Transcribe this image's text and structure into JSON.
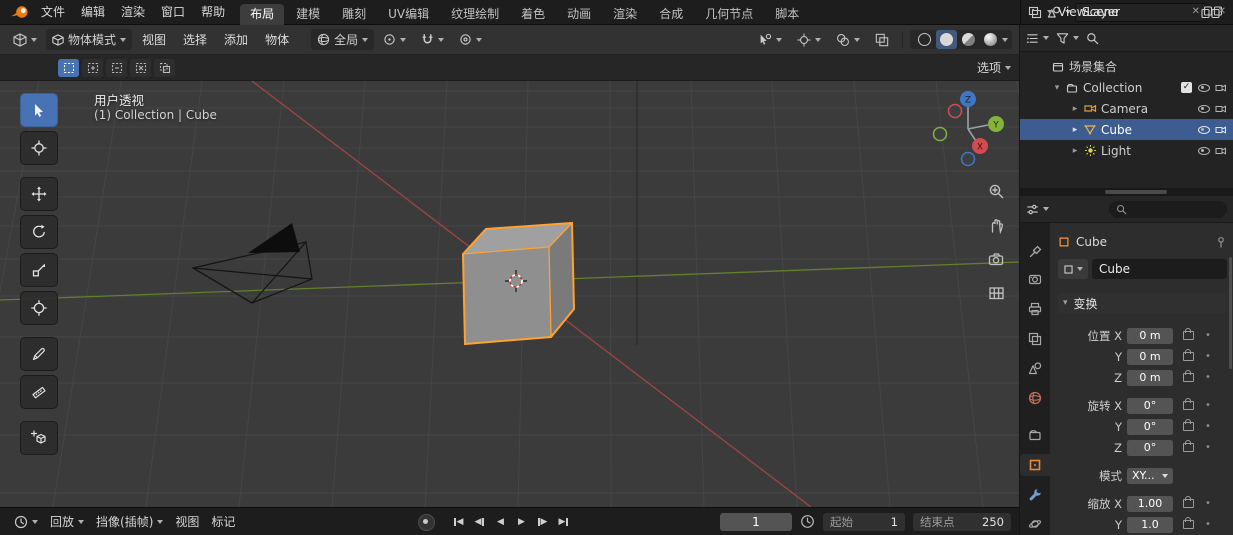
{
  "icons": {
    "disclosure_open": "▾",
    "disclosure_closed": "▸",
    "check": "✓",
    "close": "✕",
    "tri_left": "◀",
    "tri_right": "▶",
    "dot": "•"
  },
  "colors": {
    "accent": "#4772b3",
    "object_orange": "#e8883a",
    "selection_outline": "#ffa133",
    "axis_x": "#d24b52",
    "axis_y": "#84b33c",
    "axis_z": "#4076c4"
  },
  "topbar": {
    "menus": [
      {
        "label": "文件"
      },
      {
        "label": "编辑"
      },
      {
        "label": "渲染"
      },
      {
        "label": "窗口"
      },
      {
        "label": "帮助"
      }
    ],
    "tabs": [
      {
        "label": "布局"
      },
      {
        "label": "建模"
      },
      {
        "label": "雕刻"
      },
      {
        "label": "UV编辑"
      },
      {
        "label": "纹理绘制"
      },
      {
        "label": "着色"
      },
      {
        "label": "动画"
      },
      {
        "label": "渲染"
      },
      {
        "label": "合成"
      },
      {
        "label": "几何节点"
      },
      {
        "label": "脚本"
      }
    ],
    "scene_value": "Scene",
    "view_layer_value": "ViewLayer"
  },
  "viewport_header": {
    "mode": "物体模式",
    "menus": [
      {
        "label": "视图"
      },
      {
        "label": "选择"
      },
      {
        "label": "添加"
      },
      {
        "label": "物体"
      }
    ],
    "orientation": "全局",
    "options_label": "选项"
  },
  "viewport": {
    "view_name": "用户透视",
    "context_path": "(1) Collection | Cube",
    "gizmo": {
      "x": "X",
      "y": "Y",
      "z": "Z"
    }
  },
  "outliner": {
    "root": "场景集合",
    "items": [
      {
        "name": "Collection"
      },
      {
        "name": "Camera"
      },
      {
        "name": "Cube"
      },
      {
        "name": "Light"
      }
    ]
  },
  "properties": {
    "breadcrumb": "Cube",
    "name_value": "Cube",
    "transform": {
      "title": "变换",
      "rows": [
        {
          "label": "位置 X",
          "value": "0 m"
        },
        {
          "label": "Y",
          "value": "0 m"
        },
        {
          "label": "Z",
          "value": "0 m"
        },
        {
          "label": "旋转 X",
          "value": "0°"
        },
        {
          "label": "Y",
          "value": "0°"
        },
        {
          "label": "Z",
          "value": "0°"
        },
        {
          "label": "模式",
          "value": "XY..."
        },
        {
          "label": "缩放 X",
          "value": "1.00"
        },
        {
          "label": "Y",
          "value": "1.0"
        }
      ]
    }
  },
  "timeline": {
    "menus": [
      {
        "label": "回放"
      },
      {
        "label": "挡像(插帧)"
      },
      {
        "label": "视图"
      },
      {
        "label": "标记"
      }
    ],
    "current_frame": "1",
    "start_label": "起始",
    "start_value": "1",
    "end_label": "结束点",
    "end_value": "250"
  }
}
